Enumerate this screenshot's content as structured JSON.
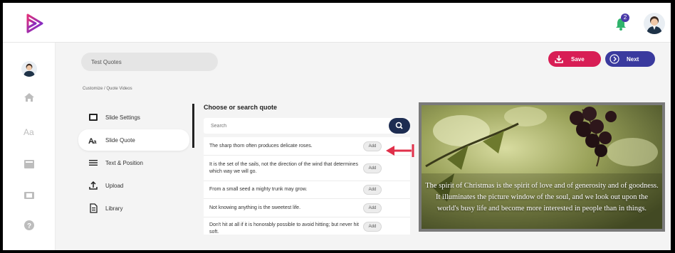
{
  "header": {
    "notification_count": "2"
  },
  "project": {
    "title_value": "Test Quotes"
  },
  "actions": {
    "save_label": "Save",
    "next_label": "Next"
  },
  "breadcrumb": {
    "text": "Customize  /  Quote Videos"
  },
  "menu": {
    "items": [
      {
        "label": "Slide Settings",
        "icon": "slide-settings-icon"
      },
      {
        "label": "Slide Quote",
        "icon": "font-icon"
      },
      {
        "label": "Text & Position",
        "icon": "align-lines-icon"
      },
      {
        "label": "Upload",
        "icon": "upload-icon"
      },
      {
        "label": "Library",
        "icon": "library-icon"
      }
    ]
  },
  "quotes": {
    "title": "Choose or search quote",
    "search_placeholder": "Search",
    "add_label": "Add",
    "items": [
      "The sharp thorn often produces delicate roses.",
      "It is the set of the sails, not the direction of the wind that determines which way we will go.",
      "From a small seed a mighty trunk may grow.",
      "Not knowing anything is the sweetest life.",
      "Don't hit at all if it is honorably possible to avoid hitting; but never hit soft."
    ]
  },
  "preview": {
    "quote_text": "The spirit of Christmas is the spirit of love and of generosity and of goodness. It illuminates the picture window of the soul, and we look out upon the world's busy life and become more interested in people than in things."
  },
  "colors": {
    "save": "#d81e55",
    "next": "#3a3a9e",
    "search_button": "#1e2d52",
    "brand": "#6a2bd9",
    "notification": "#2fb36b",
    "pointer_arrow": "#e0304a"
  }
}
